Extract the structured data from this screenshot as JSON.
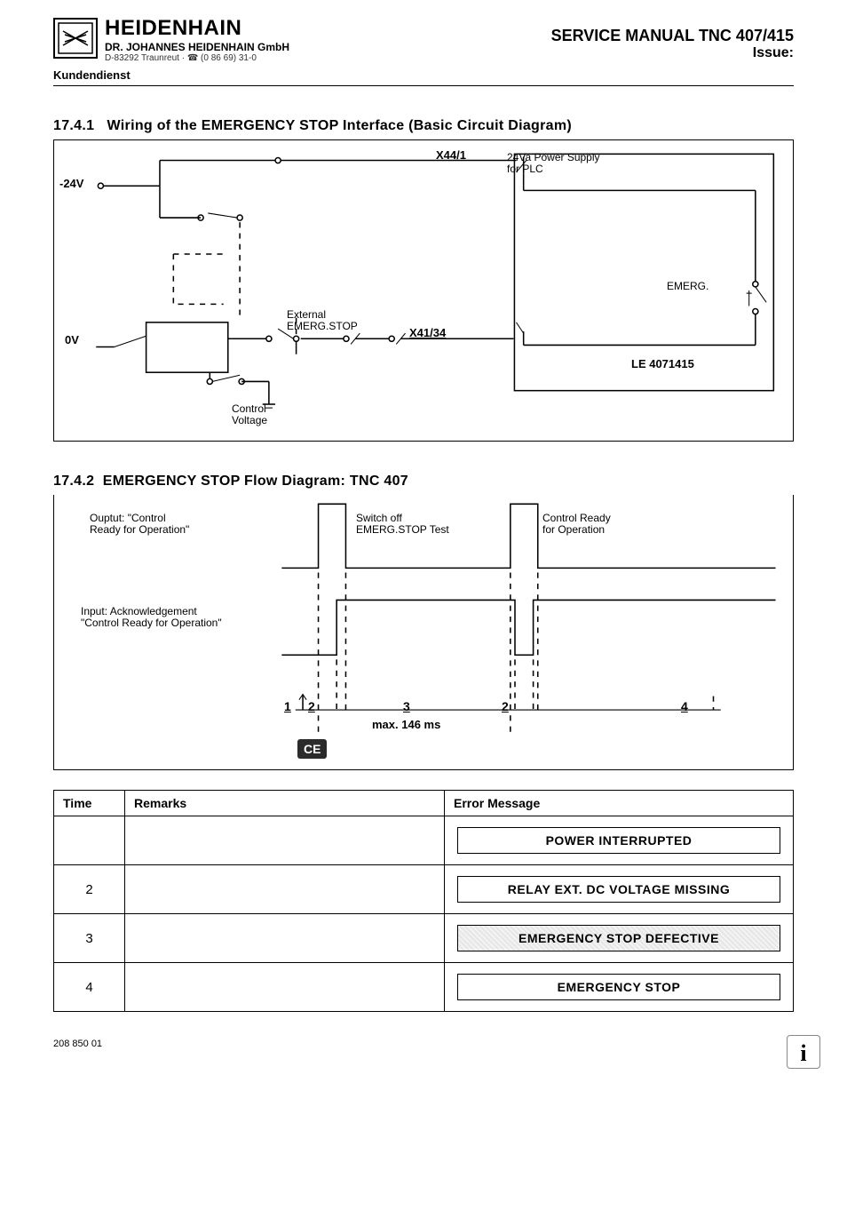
{
  "header": {
    "company": "HEIDENHAIN",
    "sub1": "DR. JOHANNES HEIDENHAIN GmbH",
    "sub2": "D-83292 Traunreut · ☎ (0 86 69) 31-0",
    "manual_title": "SERVICE MANUAL TNC 407/415",
    "issue_label": "Issue:",
    "kunden": "Kundendienst"
  },
  "section1": {
    "num": "17.4.1",
    "title": "Wiring of the EMERGENCY STOP Interface (Basic Circuit Diagram)",
    "labels": {
      "v24": "-24V",
      "v0": "0V",
      "x44": "X44/1",
      "x41": "X41/34",
      "plc": "24Va Power Supply\nfor PLC",
      "ext": "External\nEMERG.STOP",
      "emerg": "EMERG.",
      "le": "LE 4071415",
      "ctrlv": "Control\nVoltage"
    }
  },
  "section2": {
    "num": "17.4.2",
    "title": "EMERGENCY STOP Flow Diagram: TNC 407",
    "labels": {
      "out": "Ouptut: \"Control\nReady for Operation\"",
      "sw": "Switch off\nEMERG.STOP Test",
      "cr": "Control Ready\nfor Operation",
      "inp": "Input: Acknowledgement\n\"Control Ready for Operation\"",
      "max": "max. 146 ms",
      "ce": "CE",
      "n1": "1",
      "n2a": "2",
      "n3": "3",
      "n2b": "2",
      "n4": "4"
    }
  },
  "table": {
    "headers": {
      "time": "Time",
      "remarks": "Remarks",
      "msg": "Error Message"
    },
    "rows": [
      {
        "time": "",
        "remarks": "",
        "msg": "POWER  INTERRUPTED",
        "shaded": false
      },
      {
        "time": "2",
        "remarks": "",
        "msg": "RELAY EXT. DC VOLTAGE MISSING",
        "shaded": false
      },
      {
        "time": "3",
        "remarks": "",
        "msg": "EMERGENCY STOP DEFECTIVE",
        "shaded": true
      },
      {
        "time": "4",
        "remarks": "",
        "msg": "EMERGENCY  STOP",
        "shaded": false
      }
    ]
  },
  "footer": {
    "docnum": "208 850 01"
  }
}
